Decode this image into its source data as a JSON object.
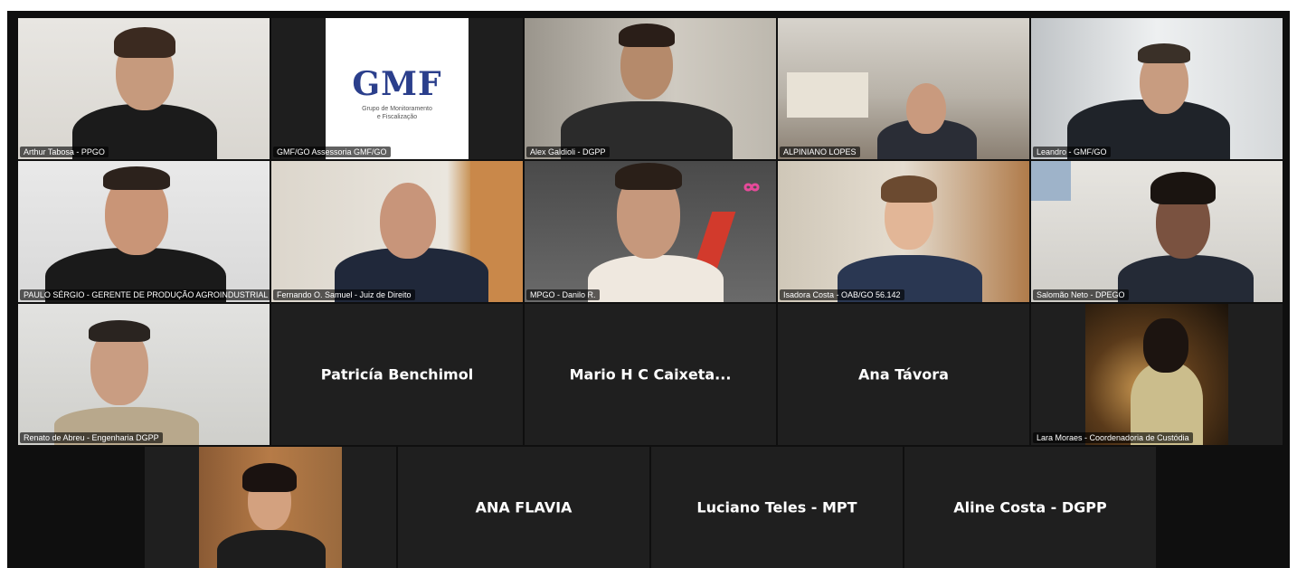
{
  "participants": {
    "p1": {
      "name": "Arthur Tabosa - PPGO"
    },
    "p2": {
      "name": "GMF/GO Assessoria GMF/GO",
      "logo_text": "GMF",
      "logo_line1": "Grupo de Monitoramento",
      "logo_line2": "e Fiscalização"
    },
    "p3": {
      "name": "Alex Galdioli - DGPP"
    },
    "p4": {
      "name": "ALPINIANO LOPES"
    },
    "p5": {
      "name": "Leandro  - GMF/GO"
    },
    "p6": {
      "name": "PAULO SÉRGIO - GERENTE DE PRODUÇÃO AGROINDUSTRIAL"
    },
    "p7": {
      "name": "Fernando O. Samuel - Juiz de Direito"
    },
    "p8": {
      "name": "MPGO - Danilo R."
    },
    "p9": {
      "name": "Isadora Costa - OAB/GO 56.142"
    },
    "p10": {
      "name": "Salomão Neto - DPEGO"
    },
    "p11": {
      "name": "Renato de Abreu - Engenharia DGPP"
    },
    "p12": {
      "name": "Patricía Benchimol"
    },
    "p13": {
      "name": "Mario H C Caixeta..."
    },
    "p14": {
      "name": "Ana Távora"
    },
    "p15": {
      "name": "Lara Moraes - Coordenadoria de Custódia"
    },
    "p16": {
      "name": ""
    },
    "p17": {
      "name": "ANA FLAVIA"
    },
    "p18": {
      "name": "Luciano Teles - MPT"
    },
    "p19": {
      "name": "Aline Costa - DGPP"
    }
  },
  "colors": {
    "stage_bg": "#0f0f0f",
    "tile_bg": "#1f1f1f",
    "gmf_blue": "#2b3f8c"
  }
}
